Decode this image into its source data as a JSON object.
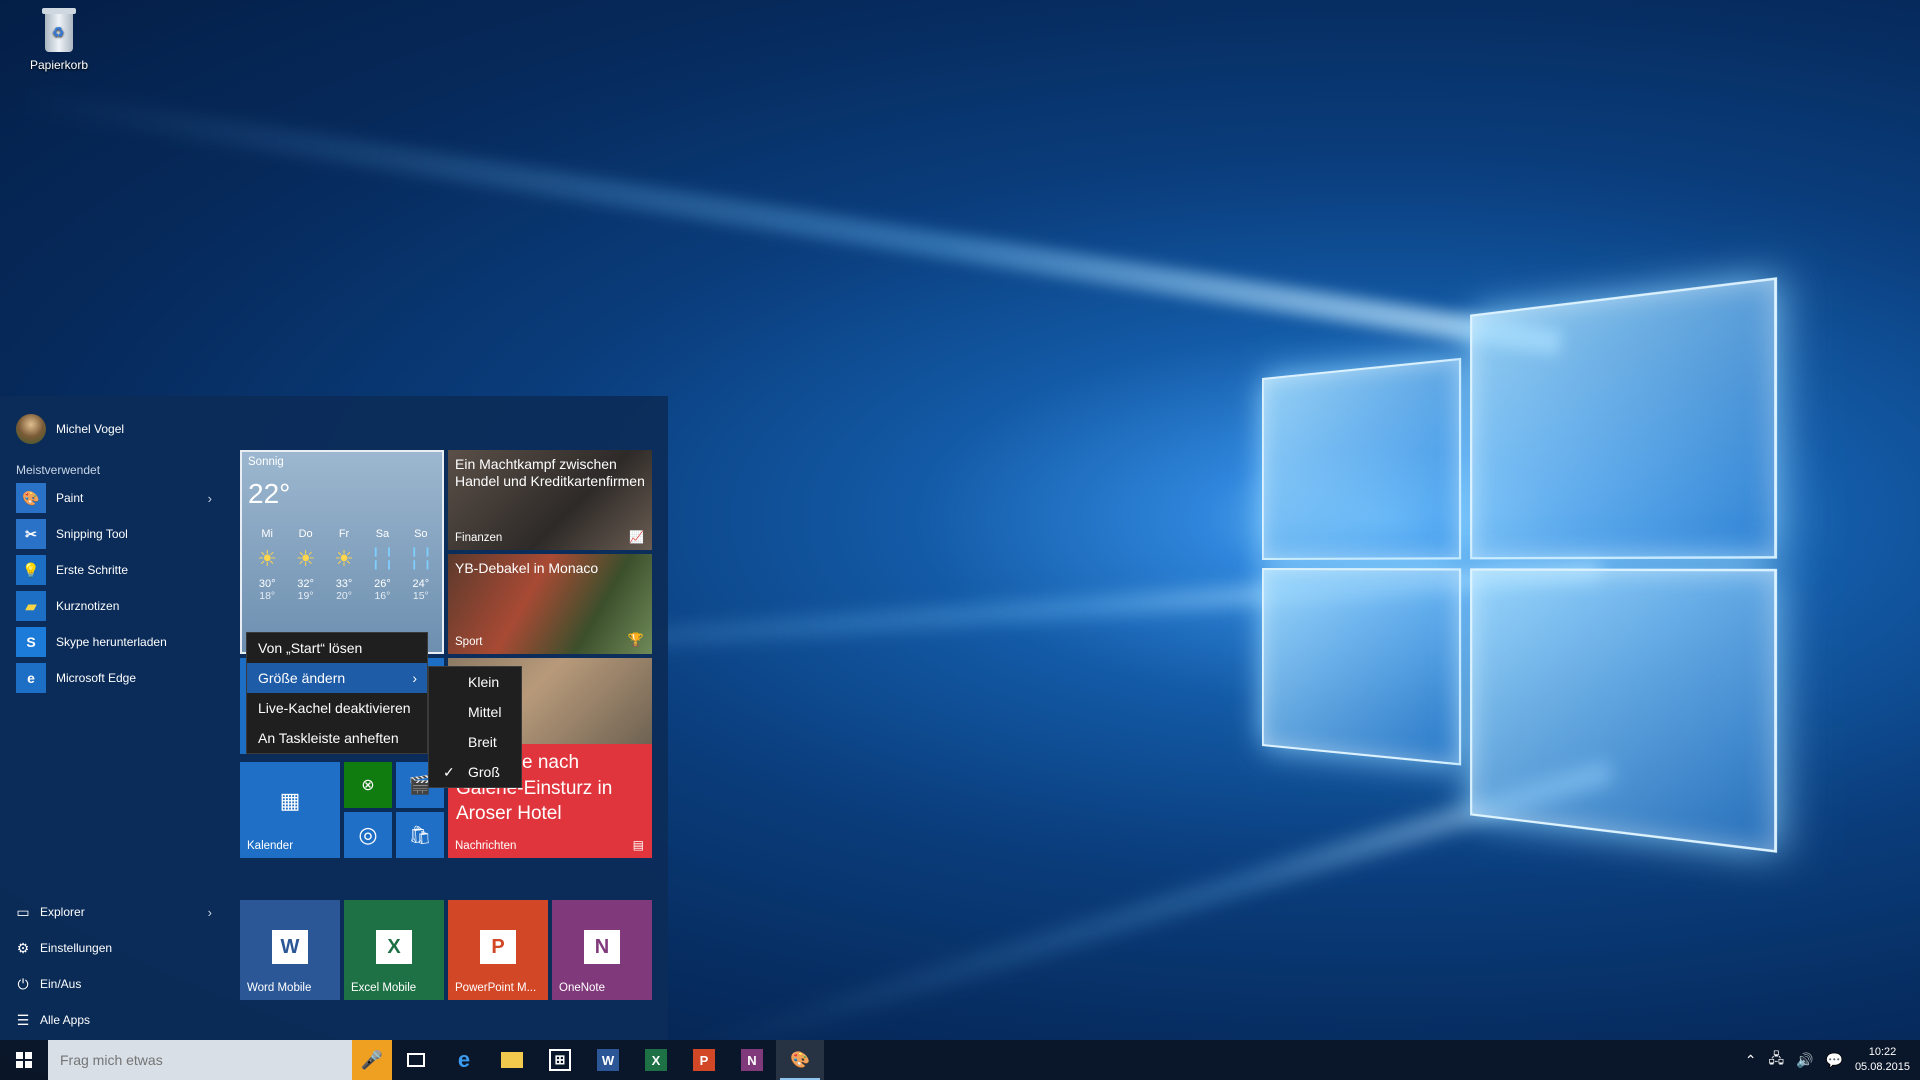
{
  "desktop": {
    "recycle_bin_label": "Papierkorb"
  },
  "start_menu": {
    "user_name": "Michel Vogel",
    "most_used_heading": "Meistverwendet",
    "apps": [
      {
        "label": "Paint",
        "icon": "paint-icon",
        "has_submenu": true
      },
      {
        "label": "Snipping Tool",
        "icon": "scissors-icon"
      },
      {
        "label": "Erste Schritte",
        "icon": "lightbulb-icon"
      },
      {
        "label": "Kurznotizen",
        "icon": "sticky-note-icon"
      },
      {
        "label": "Skype herunterladen",
        "icon": "skype-icon"
      },
      {
        "label": "Microsoft Edge",
        "icon": "edge-icon"
      }
    ],
    "bottom": {
      "explorer": "Explorer",
      "settings": "Einstellungen",
      "power": "Ein/Aus",
      "all_apps": "Alle Apps"
    }
  },
  "tiles": {
    "weather": {
      "condition": "Sonnig",
      "temp": "22°",
      "days": [
        {
          "name": "Mi",
          "high": "30°",
          "low": "18°",
          "icon": "sun-icon"
        },
        {
          "name": "Do",
          "high": "32°",
          "low": "19°",
          "icon": "sun-icon"
        },
        {
          "name": "Fr",
          "high": "33°",
          "low": "20°",
          "icon": "sun-icon"
        },
        {
          "name": "Sa",
          "high": "26°",
          "low": "16°",
          "icon": "rain-icon"
        },
        {
          "name": "So",
          "high": "24°",
          "low": "15°",
          "icon": "rain-icon"
        }
      ]
    },
    "finance": {
      "headline": "Ein Machtkampf zwischen Handel und Kreditkartenfirmen",
      "label": "Finanzen"
    },
    "sport": {
      "headline": "YB-Debakel in Monaco",
      "label": "Sport"
    },
    "news": {
      "headline_visible": "e nach",
      "headline_rest": "Galerie-Einsturz in Aroser Hotel",
      "label": "Nachrichten"
    },
    "calendar": {
      "label": "Kalender"
    },
    "office": {
      "word": "Word Mobile",
      "excel": "Excel Mobile",
      "powerpoint": "PowerPoint M...",
      "onenote": "OneNote"
    }
  },
  "context_menu": {
    "items": [
      "Von „Start“ lösen",
      "Größe ändern",
      "Live-Kachel deaktivieren",
      "An Taskleiste anheften"
    ],
    "submenu": [
      "Klein",
      "Mittel",
      "Breit",
      "Groß"
    ],
    "checked": "Groß"
  },
  "taskbar": {
    "search_placeholder": "Frag mich etwas",
    "time": "10:22",
    "date": "05.08.2015"
  },
  "colors": {
    "accent": "#1e5ca8",
    "start_bg": "#0c2c58",
    "news_red": "#e0353c",
    "word_blue": "#2b5797",
    "excel_green": "#1e7145",
    "ppt_orange": "#d24726",
    "onenote_purple": "#80397b",
    "xbox_green": "#107c10"
  }
}
